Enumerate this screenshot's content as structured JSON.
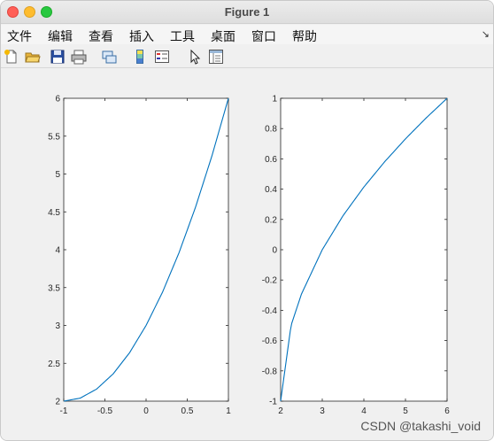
{
  "window": {
    "title": "Figure 1"
  },
  "menu": [
    "文件",
    "编辑",
    "查看",
    "插入",
    "工具",
    "桌面",
    "窗口",
    "帮助"
  ],
  "toolbar_icons": [
    "new-figure-icon",
    "open-file-icon",
    "save-icon",
    "print-icon",
    "link-icon",
    "colorbar-icon",
    "legend-icon",
    "pointer-icon",
    "property-inspector-icon"
  ],
  "watermark": "CSDN @takashi_void",
  "chart_data": [
    {
      "type": "line",
      "x": [
        -1,
        -0.8,
        -0.6,
        -0.4,
        -0.2,
        0,
        0.2,
        0.4,
        0.6,
        0.8,
        1
      ],
      "series": [
        {
          "values": [
            2,
            2.04,
            2.16,
            2.36,
            2.64,
            3,
            3.44,
            3.96,
            4.56,
            5.24,
            6
          ]
        }
      ],
      "xlim": [
        -1,
        1
      ],
      "ylim": [
        2,
        6
      ],
      "xticks": [
        "-1",
        "-0.5",
        "0",
        "0.5",
        "1"
      ],
      "yticks": [
        "2",
        "2.5",
        "3",
        "3.5",
        "4",
        "4.5",
        "5",
        "5.5",
        "6"
      ],
      "color": "#0072bd",
      "grid": false
    },
    {
      "type": "line",
      "x": [
        2,
        2.25,
        2.5,
        3,
        3.5,
        4,
        4.5,
        5,
        5.5,
        6
      ],
      "series": [
        {
          "values": [
            -1,
            -0.5,
            -0.293,
            0,
            0.225,
            0.414,
            0.581,
            0.732,
            0.871,
            1
          ]
        }
      ],
      "xlim": [
        2,
        6
      ],
      "ylim": [
        -1,
        1
      ],
      "xticks": [
        "2",
        "3",
        "4",
        "5",
        "6"
      ],
      "yticks": [
        "-1",
        "-0.8",
        "-0.6",
        "-0.4",
        "-0.2",
        "0",
        "0.2",
        "0.4",
        "0.6",
        "0.8",
        "1"
      ],
      "color": "#0072bd",
      "grid": false
    }
  ]
}
